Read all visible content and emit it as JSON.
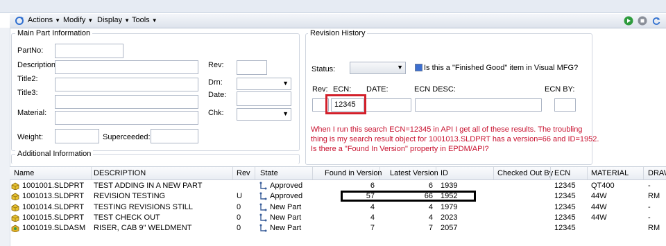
{
  "toolbar": {
    "actions": "Actions",
    "modify": "Modify",
    "display": "Display",
    "tools": "Tools"
  },
  "main_part": {
    "title": "Main Part Information",
    "partno_label": "PartNo:",
    "description_label": "Description:",
    "title2_label": "Title2:",
    "title3_label": "Title3:",
    "material_label": "Material:",
    "weight_label": "Weight:",
    "superceeded_label": "Superceeded:",
    "rev_label": "Rev:",
    "drn_label": "Drn:",
    "date_label": "Date:",
    "chk_label": "Chk:"
  },
  "additional": {
    "title": "Additional Information"
  },
  "revision": {
    "title": "Revision History",
    "status_label": "Status:",
    "finished_good_label": "Is this a \"Finished Good\" item in Visual MFG?",
    "rev_label": "Rev:",
    "ecn_label": "ECN:",
    "date_label": "DATE:",
    "ecn_desc_label": "ECN DESC:",
    "ecn_by_label": "ECN BY:",
    "ecn_value": "12345"
  },
  "annotation": {
    "lines": [
      "When I run this search ECN=12345 in API I get all of these results. The troubling",
      "thing is my search result object for 1001013.SLDPRT has a version=66 and ID=1952.",
      "Is there a \"Found In Version\" property in EPDM/API?"
    ]
  },
  "grid": {
    "headers": [
      "Name",
      "DESCRIPTION",
      "Rev",
      "State",
      "Found in Version",
      "Latest Version",
      "ID",
      "Checked Out By",
      "ECN",
      "MATERIAL",
      "DRAW"
    ],
    "rows": [
      {
        "name": "1001001.SLDPRT",
        "description": "TEST ADDING IN A NEW PART",
        "rev": "",
        "state": "Approved",
        "found": "6",
        "latest": "6",
        "id": "1939",
        "checked_out": "",
        "ecn": "12345",
        "material": "QT400",
        "draw": "-"
      },
      {
        "name": "1001013.SLDPRT",
        "description": "REVISION TESTING",
        "rev": "U",
        "state": "Approved",
        "found": "57",
        "latest": "66",
        "id": "1952",
        "checked_out": "",
        "ecn": "12345",
        "material": "44W",
        "draw": "RM"
      },
      {
        "name": "1001014.SLDPRT",
        "description": "TESTING REVISIONS STILL",
        "rev": "0",
        "state": "New Part",
        "found": "4",
        "latest": "4",
        "id": "1979",
        "checked_out": "",
        "ecn": "12345",
        "material": "44W",
        "draw": "-"
      },
      {
        "name": "1001015.SLDPRT",
        "description": "TEST CHECK OUT",
        "rev": "0",
        "state": "New Part",
        "found": "4",
        "latest": "4",
        "id": "2023",
        "checked_out": "",
        "ecn": "12345",
        "material": "44W",
        "draw": "-"
      },
      {
        "name": "1001019.SLDASM",
        "description": "RISER, CAB 9\" WELDMENT",
        "rev": "0",
        "state": "New Part",
        "found": "7",
        "latest": "7",
        "id": "2057",
        "checked_out": "",
        "ecn": "12345",
        "material": "",
        "draw": "RM"
      }
    ]
  },
  "colors": {
    "annotation": "#c8102e",
    "highlight_red": "#d21f2a",
    "highlight_black": "#000000"
  }
}
